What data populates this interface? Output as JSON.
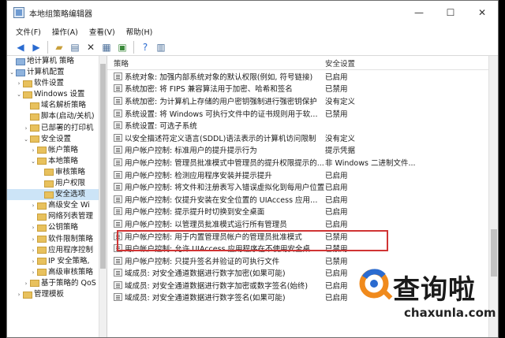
{
  "window": {
    "title": "本地组策略编辑器",
    "controls": {
      "minimize": "—",
      "maximize": "☐",
      "close": "✕"
    }
  },
  "menu": [
    "文件(F)",
    "操作(A)",
    "查看(V)",
    "帮助(H)"
  ],
  "tree": [
    {
      "label": "地计算机 策略",
      "indent": 0,
      "exp": "",
      "icon": "pc"
    },
    {
      "label": "计算机配置",
      "indent": 0,
      "exp": "⌄",
      "icon": "pc"
    },
    {
      "label": "软件设置",
      "indent": 1,
      "exp": "›",
      "icon": "folder"
    },
    {
      "label": "Windows 设置",
      "indent": 1,
      "exp": "⌄",
      "icon": "folder"
    },
    {
      "label": "域名解析策略",
      "indent": 2,
      "exp": "",
      "icon": "folder"
    },
    {
      "label": "脚本(启动/关机)",
      "indent": 2,
      "exp": "",
      "icon": "folder"
    },
    {
      "label": "已部署的打印机",
      "indent": 2,
      "exp": "›",
      "icon": "folder"
    },
    {
      "label": "安全设置",
      "indent": 2,
      "exp": "⌄",
      "icon": "folder"
    },
    {
      "label": "帐户策略",
      "indent": 3,
      "exp": "›",
      "icon": "folder"
    },
    {
      "label": "本地策略",
      "indent": 3,
      "exp": "⌄",
      "icon": "folder"
    },
    {
      "label": "审核策略",
      "indent": 4,
      "exp": "",
      "icon": "folder"
    },
    {
      "label": "用户权限",
      "indent": 4,
      "exp": "",
      "icon": "folder"
    },
    {
      "label": "安全选项",
      "indent": 4,
      "exp": "",
      "icon": "folder",
      "selected": true
    },
    {
      "label": "高级安全 Wi",
      "indent": 3,
      "exp": "›",
      "icon": "folder"
    },
    {
      "label": "网络列表管理",
      "indent": 3,
      "exp": "",
      "icon": "folder"
    },
    {
      "label": "公钥策略",
      "indent": 3,
      "exp": "›",
      "icon": "folder"
    },
    {
      "label": "软件限制策略",
      "indent": 3,
      "exp": "›",
      "icon": "folder"
    },
    {
      "label": "应用程序控制",
      "indent": 3,
      "exp": "›",
      "icon": "folder"
    },
    {
      "label": "IP 安全策略,",
      "indent": 3,
      "exp": "›",
      "icon": "folder"
    },
    {
      "label": "高级审核策略",
      "indent": 3,
      "exp": "›",
      "icon": "folder"
    },
    {
      "label": "基于策略的 QoS",
      "indent": 2,
      "exp": "›",
      "icon": "folder"
    },
    {
      "label": "管理模板",
      "indent": 1,
      "exp": "›",
      "icon": "folder"
    }
  ],
  "list": {
    "headers": {
      "policy": "策略",
      "setting": "安全设置"
    },
    "rows": [
      {
        "policy": "系统对象: 加强内部系统对象的默认权限(例如, 符号链接)",
        "setting": "已启用"
      },
      {
        "policy": "系统加密: 将 FIPS 兼容算法用于加密、哈希和签名",
        "setting": "已禁用"
      },
      {
        "policy": "系统加密: 为计算机上存储的用户密钥强制进行强密钥保护",
        "setting": "没有定义"
      },
      {
        "policy": "系统设置: 将 Windows 可执行文件中的证书规则用于软件限...",
        "setting": "已禁用"
      },
      {
        "policy": "系统设置: 可选子系统",
        "setting": ""
      },
      {
        "policy": "以安全描述符定义语言(SDDL)语法表示的计算机访问限制",
        "setting": "没有定义"
      },
      {
        "policy": "用户帐户控制: 标准用户的提升提示行为",
        "setting": "提示凭据"
      },
      {
        "policy": "用户帐户控制: 管理员批准模式中管理员的提升权限提示的...",
        "setting": "非 Windows 二进制文件..."
      },
      {
        "policy": "用户帐户控制: 检测应用程序安装并提示提升",
        "setting": "已启用"
      },
      {
        "policy": "用户帐户控制: 将文件和注册表写入错误虚拟化到每用户位置",
        "setting": "已启用"
      },
      {
        "policy": "用户帐户控制: 仅提升安装在安全位置的 UIAccess 应用程序",
        "setting": "已启用"
      },
      {
        "policy": "用户帐户控制: 提示提升时切换到安全桌面",
        "setting": "已启用"
      },
      {
        "policy": "用户帐户控制: 以管理员批准模式运行所有管理员",
        "setting": "已启用"
      },
      {
        "policy": "用户帐户控制: 用于内置管理员帐户的管理员批准模式",
        "setting": "已禁用"
      },
      {
        "policy": "用户帐户控制: 允许 UIAccess 应用程序在不使用安全桌面的...",
        "setting": "已禁用"
      },
      {
        "policy": "用户帐户控制: 只提升签名并验证的可执行文件",
        "setting": "已禁用"
      },
      {
        "policy": "域成员: 对安全通道数据进行数字加密(如果可能)",
        "setting": "已启用"
      },
      {
        "policy": "域成员: 对安全通道数据进行数字加密或数字签名(始终)",
        "setting": "已启用"
      },
      {
        "policy": "域成员: 对安全通道数据进行数字签名(如果可能)",
        "setting": "已启用"
      }
    ]
  },
  "watermark": {
    "brand": "查询啦",
    "domain": "chaxunla.com"
  },
  "colors": {
    "highlight": "#d03434",
    "selected": "#cce4f7"
  }
}
